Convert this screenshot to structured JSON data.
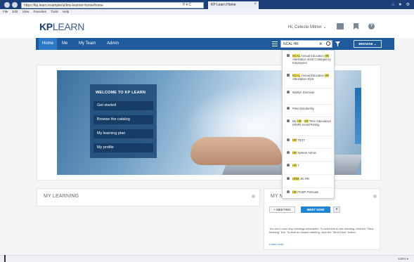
{
  "browser": {
    "address": "https://kp.learn.example/ui/lms-learner-home/home",
    "address_tools": "P ▾ C",
    "tab_title": "KP Learn Home",
    "tab_close": "×",
    "menu": [
      "File",
      "Edit",
      "View",
      "Favorites",
      "Tools",
      "Help"
    ],
    "right_icons": "⌂ ★ ⚙"
  },
  "app": {
    "logo_bold": "KP",
    "logo_light": "LEARN",
    "user_greeting": "Hi, Celeste Mitner ⌄"
  },
  "nav": {
    "items": [
      "Home",
      "Me",
      "My Team",
      "Admin"
    ],
    "active_index": 0,
    "search_value": "NCAL HR",
    "search_clear": "×",
    "browse_label": "BROWSE ⌄"
  },
  "hero": {
    "welcome": "WELCOME TO KP LEARN",
    "buttons": [
      "Get started",
      "Browse the catalog",
      "My learning plan",
      "My profile"
    ]
  },
  "dropdown": {
    "items": [
      {
        "icon": "doc",
        "parts": [
          {
            "t": "NCAL",
            "h": true
          },
          {
            "t": " Annual Education ",
            "h": false
          },
          {
            "t": "HR",
            "h": true
          },
          {
            "t": " Attestation 2019 Contingency Employees",
            "h": false
          }
        ]
      },
      {
        "icon": "doc",
        "parts": [
          {
            "t": "NCAL",
            "h": true
          },
          {
            "t": " Annual Education ",
            "h": false
          },
          {
            "t": "HR",
            "h": true
          },
          {
            "t": " Attestation 2019",
            "h": false
          }
        ]
      },
      {
        "icon": "person",
        "parts": [
          {
            "t": "Marilyn Donovan",
            "h": false
          }
        ]
      },
      {
        "icon": "person",
        "parts": [
          {
            "t": "Peter Bondorsky",
            "h": false
          }
        ]
      },
      {
        "icon": "person",
        "parts": [
          {
            "t": "My ",
            "h": false
          },
          {
            "t": "HR",
            "h": true
          },
          {
            "t": " - ",
            "h": false
          },
          {
            "t": "HR",
            "h": true
          },
          {
            "t": " Time Attendance (MHR) Acute/Testing",
            "h": false
          }
        ]
      },
      {
        "icon": "person",
        "parts": [
          {
            "t": "HR",
            "h": true
          },
          {
            "t": " TEST",
            "h": false
          }
        ]
      },
      {
        "icon": "person",
        "parts": [
          {
            "t": "HR",
            "h": true
          },
          {
            "t": " System Admin",
            "h": false
          }
        ]
      },
      {
        "icon": "person",
        "parts": [
          {
            "t": "HR",
            "h": true
          },
          {
            "t": " 7",
            "h": false
          }
        ]
      },
      {
        "icon": "person",
        "parts": [
          {
            "t": "HRM",
            "h": true
          },
          {
            "t": " JIC RR",
            "h": false
          }
        ]
      },
      {
        "icon": "person",
        "parts": [
          {
            "t": "HR",
            "h": true
          },
          {
            "t": " PCMP PSGoals",
            "h": false
          }
        ]
      }
    ]
  },
  "cards": {
    "my_learning": "MY LEARNING",
    "my_meetings": "MY M",
    "meeting_btn": "+ MEETING",
    "meet_now_btn": "MEET NOW",
    "more_btn": "▾",
    "meet_text": "You don't have any meetings scheduled. To schedule a new meeting, click the \"New Meeting\" link. To start an instant meeting, click the \"Meet Now\" button.",
    "learn_more": "Learn more"
  },
  "status": {
    "zoom": "100% ▾"
  }
}
